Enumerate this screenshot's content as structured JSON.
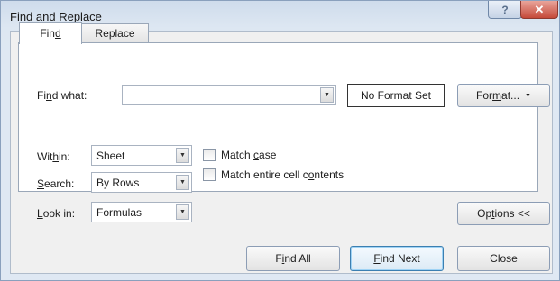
{
  "window": {
    "title": "Find and Replace",
    "help_glyph": "?",
    "close_glyph": "✕"
  },
  "tabs": [
    {
      "label": "Find",
      "active": true
    },
    {
      "label": "Replace",
      "active": false
    }
  ],
  "find_what": {
    "label_pre": "Fi",
    "label_ul": "n",
    "label_post": "d what:",
    "value": "",
    "arrow": "▼"
  },
  "format_status": "No Format Set",
  "format_button": {
    "label_pre": "For",
    "label_ul": "m",
    "label_post": "at...",
    "arrow": "▼"
  },
  "within": {
    "label_pre": "Wit",
    "label_ul": "h",
    "label_post": "in:",
    "value": "Sheet",
    "arrow": "▼"
  },
  "search": {
    "label_ul": "S",
    "label_post": "earch:",
    "value": "By Rows",
    "arrow": "▼"
  },
  "look_in": {
    "label_ul": "L",
    "label_post": "ook in:",
    "value": "Formulas",
    "arrow": "▼"
  },
  "match_case": {
    "label_pre": "Match ",
    "label_ul": "c",
    "label_post": "ase",
    "checked": false
  },
  "match_entire": {
    "label_pre": "Match entire cell c",
    "label_ul": "o",
    "label_post": "ntents",
    "checked": false
  },
  "options_button": {
    "label_pre": "Op",
    "label_ul": "t",
    "label_post": "ions <<"
  },
  "buttons": {
    "find_all": {
      "label_pre": "F",
      "label_ul": "i",
      "label_post": "nd All"
    },
    "find_next": {
      "label_pre": "",
      "label_ul": "F",
      "label_post": "ind Next"
    },
    "close": {
      "label": "Close"
    }
  },
  "colors": {
    "title_bar": "#cfdcec",
    "close_button": "#c54a3a",
    "default_button_border": "#3c7fb1"
  }
}
